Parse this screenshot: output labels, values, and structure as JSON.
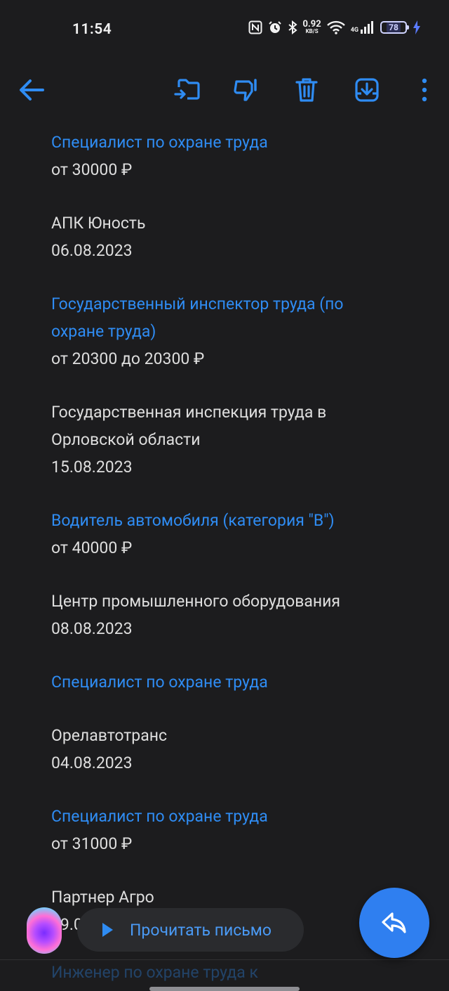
{
  "status": {
    "time": "11:54",
    "net_speed_value": "0.92",
    "net_speed_unit": "KB/S",
    "network": "4G",
    "battery": "78"
  },
  "toolbar": {
    "back": "arrow-left-icon",
    "move": "move-to-folder-icon",
    "spam": "thumbs-down-icon",
    "delete": "trash-icon",
    "archive": "archive-download-icon",
    "more": "more-vertical-icon"
  },
  "listings": [
    {
      "title": [
        "Специалист по охране труда"
      ],
      "salary": "от 30000 ₽",
      "company": [
        "АПК Юность"
      ],
      "date": "06.08.2023"
    },
    {
      "title": [
        "Государственный инспектор труда (по",
        "охране труда)"
      ],
      "salary": "от 20300 до 20300 ₽",
      "company": [
        "Государственная инспекция труда в",
        "Орловской области"
      ],
      "date": "15.08.2023"
    },
    {
      "title": [
        "Водитель автомобиля (категория \"B\")"
      ],
      "salary": "от 40000 ₽",
      "company": [
        "Центр промышленного оборудования"
      ],
      "date": "08.08.2023"
    },
    {
      "title": [
        "Специалист по охране труда"
      ],
      "salary": "",
      "company": [
        "Орелавтотранс"
      ],
      "date": "04.08.2023"
    },
    {
      "title": [
        "Специалист по охране труда"
      ],
      "salary": "от 31000 ₽",
      "company": [
        "Партнер Агро"
      ],
      "date": "09.0"
    }
  ],
  "next_title_partial": "Инженер по охране труда к",
  "read_aloud_label": "Прочитать письмо",
  "colors": {
    "accent": "#2f8cf3",
    "background": "#1c1c1e",
    "fab": "#2f7ff0"
  }
}
